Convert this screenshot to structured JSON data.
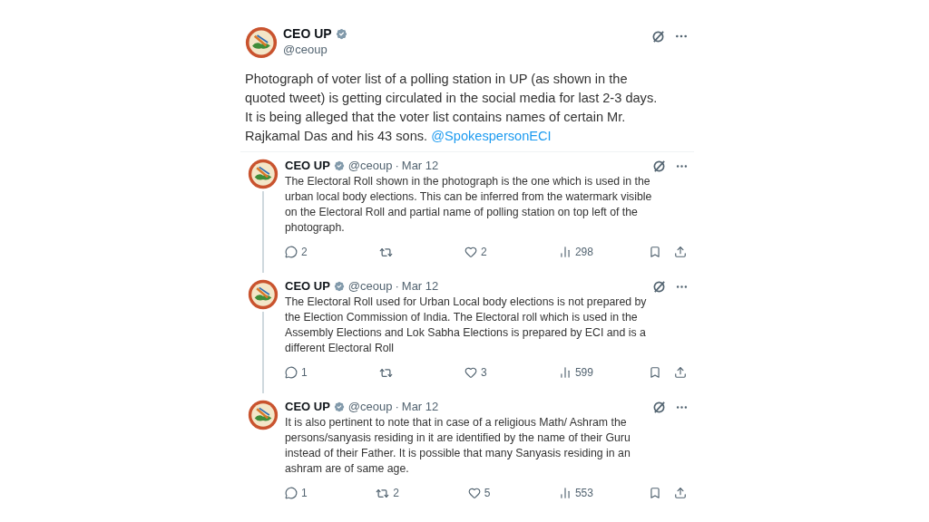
{
  "main_tweet": {
    "name": "CEO UP",
    "handle": "@ceoup",
    "text": "Photograph of voter list of a polling station in UP (as shown in  the quoted tweet) is getting circulated in the social media for last 2-3 days. It is being alleged that the voter list contains names of certain Mr. Rajkamal Das and his 43 sons.",
    "mention": "@SpokespersonECI"
  },
  "replies": [
    {
      "name": "CEO UP",
      "handle": "@ceoup",
      "separator": "·",
      "date": "Mar 12",
      "text": "The Electoral Roll shown in the photograph is the one which is used in the urban local body elections. This can be inferred from the watermark visible on the Electoral Roll and partial name of polling station on top left of the photograph.",
      "replies": "2",
      "likes": "2",
      "views": "298"
    },
    {
      "name": "CEO UP",
      "handle": "@ceoup",
      "separator": "·",
      "date": "Mar 12",
      "text": "The  Electoral Roll used for Urban Local body elections is not prepared by the Election Commission of India. The Electoral roll which is used in the Assembly Elections and Lok Sabha Elections is prepared by ECI and is a different Electoral Roll",
      "replies": "1",
      "likes": "3",
      "views": "599"
    },
    {
      "name": "CEO UP",
      "handle": "@ceoup",
      "separator": "·",
      "date": "Mar 12",
      "text": "It is also pertinent to note that in case of a religious Math/ Ashram the persons/sanyasis residing in it are identified by the name of their Guru instead of their Father. It is possible that many Sanyasis residing in an ashram are of same age.",
      "replies": "1",
      "reposts": "2",
      "likes": "5",
      "views": "553"
    }
  ]
}
